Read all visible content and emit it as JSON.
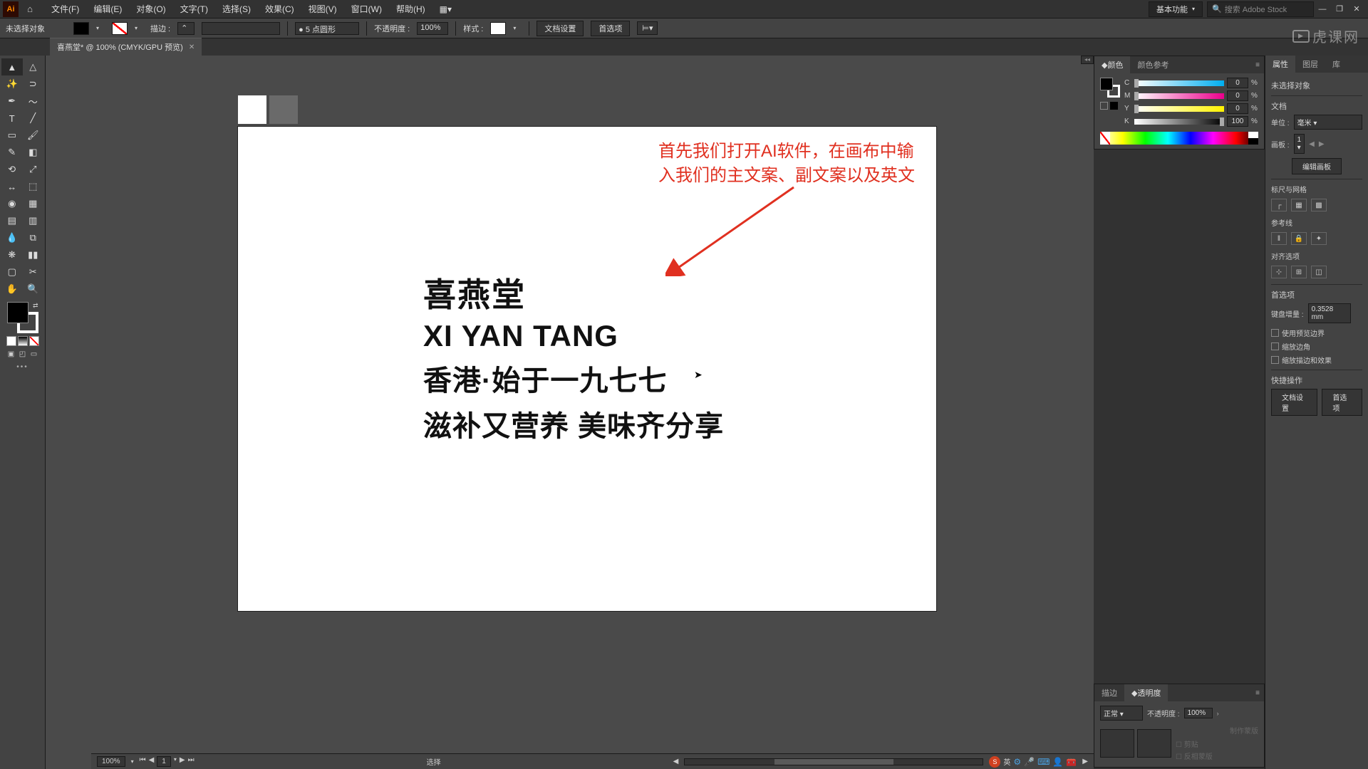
{
  "app": {
    "logo": "Ai"
  },
  "menu": {
    "file": "文件(F)",
    "edit": "编辑(E)",
    "object": "对象(O)",
    "type": "文字(T)",
    "select": "选择(S)",
    "effect": "效果(C)",
    "view": "视图(V)",
    "window": "窗口(W)",
    "help": "帮助(H)"
  },
  "topright": {
    "workspace": "基本功能",
    "search_placeholder": "搜索 Adobe Stock"
  },
  "control": {
    "noselection": "未选择对象",
    "stroke_label": "描边 :",
    "stroke_style": "5 点圆形",
    "opacity_label": "不透明度 :",
    "opacity_value": "100%",
    "style_label": "样式 :",
    "docsetup": "文档设置",
    "prefs": "首选项"
  },
  "tab": {
    "title": "喜燕堂* @ 100% (CMYK/GPU 预览)"
  },
  "canvas": {
    "red_line1": "首先我们打开AI软件，在画布中输",
    "red_line2": "入我们的主文案、副文案以及英文",
    "line1": "喜燕堂",
    "line2": "XI YAN TANG",
    "line3": "香港·始于一九七七",
    "line4": "滋补又营养 美味齐分享"
  },
  "status": {
    "zoom": "100%",
    "page": "1",
    "mid": "选择"
  },
  "panels": {
    "color": {
      "tab1": "颜色",
      "tab2": "颜色参考",
      "c": "0",
      "m": "0",
      "y": "0",
      "k": "100"
    },
    "stroke": {
      "tab1": "描边",
      "tab2": "透明度",
      "blend": "正常",
      "opacity_label": "不透明度 :",
      "opacity": "100%",
      "makemask": "制作蒙版",
      "clip": "剪贴",
      "invert": "反相蒙版"
    },
    "prop": {
      "tab1": "属性",
      "tab2": "图层",
      "tab3": "库",
      "noselection": "未选择对象",
      "doc": "文档",
      "unit_label": "单位 :",
      "unit": "毫米",
      "artboard_label": "画板 :",
      "artboard": "1",
      "editartboard": "编辑画板",
      "rulergrid": "标尺与网格",
      "guides": "参考线",
      "snap": "对齐选项",
      "prefs": "首选项",
      "keyincr_label": "键盘增量 :",
      "keyincr": "0.3528 mm",
      "preview": "使用预览边界",
      "scalecorner": "缩放边角",
      "scalestroke": "缩放描边和效果",
      "quickact": "快捷操作",
      "docsetup": "文档设置",
      "prefbtn": "首选项"
    }
  },
  "watermark": "虎课网"
}
